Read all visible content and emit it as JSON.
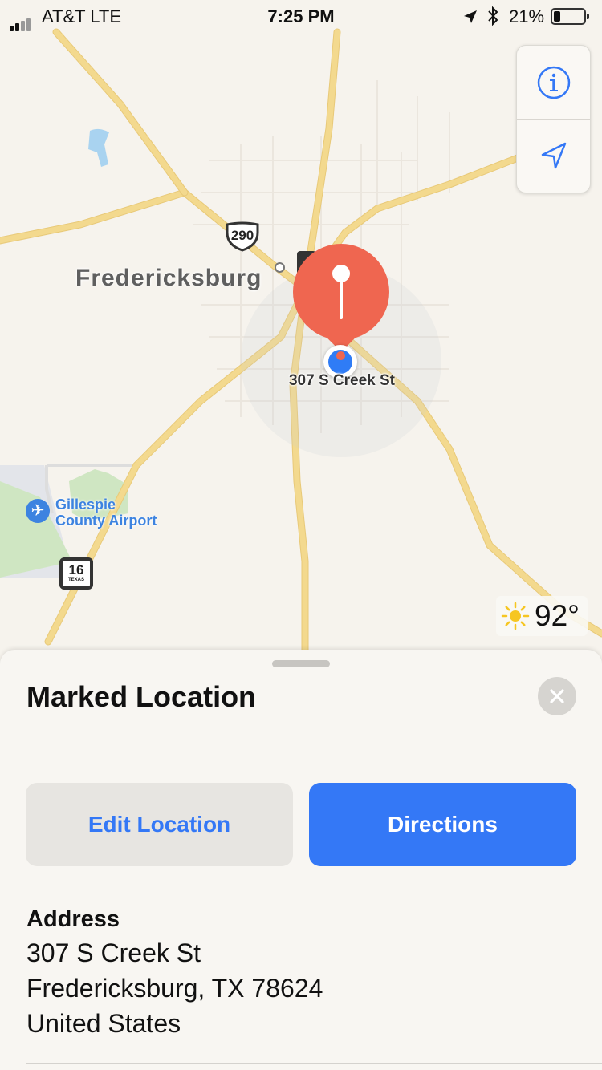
{
  "status_bar": {
    "carrier": "AT&T  LTE",
    "time": "7:25 PM",
    "battery_percent": "21%",
    "battery_level": 0.21,
    "icons": [
      "signal-icon",
      "location-arrow-icon",
      "bluetooth-icon",
      "battery-icon"
    ]
  },
  "map": {
    "town_label": "Fredericksburg",
    "highway_us": "290",
    "highway_texas_number": "16",
    "highway_texas_state": "TEXAS",
    "airport_name_line1": "Gillespie",
    "airport_name_line2": "County Airport",
    "pin_label": "307 S Creek St",
    "controls": {
      "info_icon": "info-icon",
      "location_icon": "location-arrow-icon"
    },
    "weather": {
      "icon": "sun-icon",
      "temperature": "92°"
    },
    "colors": {
      "pin": "#ef6650",
      "user_dot": "#2f7cf6",
      "road": "#f3d98e",
      "airport": "#3d83e0"
    }
  },
  "sheet": {
    "title": "Marked Location",
    "close_icon": "close-icon",
    "edit_button": "Edit Location",
    "directions_button": "Directions",
    "address_label": "Address",
    "address_line1": "307 S Creek St",
    "address_line2": "Fredericksburg, TX  78624",
    "address_line3": "United States",
    "colors": {
      "accent": "#3478f6"
    }
  }
}
